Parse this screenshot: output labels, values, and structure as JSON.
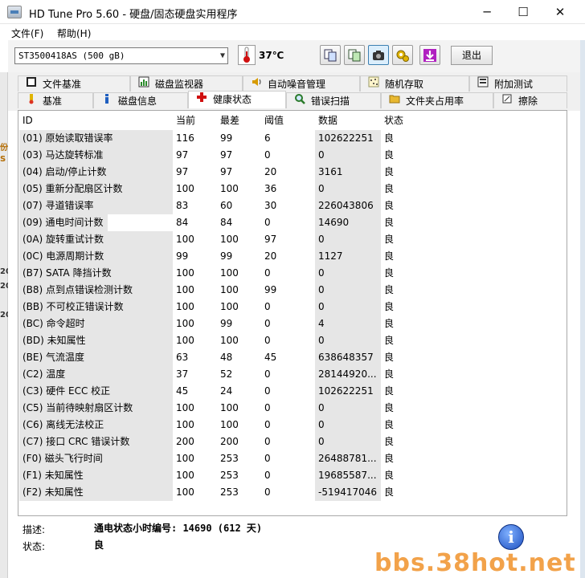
{
  "window": {
    "title": "HD Tune Pro 5.60 - 硬盘/固态硬盘实用程序",
    "minimize": "─",
    "maximize": "☐",
    "close": "✕"
  },
  "menu": {
    "file": "文件(F)",
    "help": "帮助(H)"
  },
  "toolbar": {
    "drive": "ST3500418AS (500 gB)",
    "temperature": "37℃",
    "exit_label": "退出"
  },
  "tabs_row1": [
    {
      "label": "文件基准",
      "icon": "file-benchmark-icon"
    },
    {
      "label": "磁盘监视器",
      "icon": "disk-monitor-icon"
    },
    {
      "label": "自动噪音管理",
      "icon": "speaker-icon"
    },
    {
      "label": "随机存取",
      "icon": "random-access-icon"
    },
    {
      "label": "附加测试",
      "icon": "extra-tests-icon"
    }
  ],
  "tabs_row2": [
    {
      "label": "基准",
      "icon": "benchmark-icon"
    },
    {
      "label": "磁盘信息",
      "icon": "info-icon"
    },
    {
      "label": "健康状态",
      "icon": "health-cross-icon"
    },
    {
      "label": "错误扫描",
      "icon": "magnifier-icon"
    },
    {
      "label": "文件夹占用率",
      "icon": "folder-icon"
    },
    {
      "label": "擦除",
      "icon": "erase-icon"
    }
  ],
  "table": {
    "headers": [
      "ID",
      "当前",
      "最差",
      "阈值",
      "数据",
      "状态"
    ],
    "rows": [
      [
        "(01) 原始读取错误率",
        "116",
        "99",
        "6",
        "102622251",
        "良"
      ],
      [
        "(03) 马达旋转标准",
        "97",
        "97",
        "0",
        "0",
        "良"
      ],
      [
        "(04) 启动/停止计数",
        "97",
        "97",
        "20",
        "3161",
        "良"
      ],
      [
        "(05) 重新分配扇区计数",
        "100",
        "100",
        "36",
        "0",
        "良"
      ],
      [
        "(07) 寻道错误率",
        "83",
        "60",
        "30",
        "226043806",
        "良"
      ],
      [
        "(09) 通电时间计数",
        "84",
        "84",
        "0",
        "14690",
        "良"
      ],
      [
        "(0A) 旋转重试计数",
        "100",
        "100",
        "97",
        "0",
        "良"
      ],
      [
        "(0C) 电源周期计数",
        "99",
        "99",
        "20",
        "1127",
        "良"
      ],
      [
        "(B7) SATA 降挡计数",
        "100",
        "100",
        "0",
        "0",
        "良"
      ],
      [
        "(B8) 点到点错误检测计数",
        "100",
        "100",
        "99",
        "0",
        "良"
      ],
      [
        "(BB) 不可校正错误计数",
        "100",
        "100",
        "0",
        "0",
        "良"
      ],
      [
        "(BC) 命令超时",
        "100",
        "99",
        "0",
        "4",
        "良"
      ],
      [
        "(BD) 未知属性",
        "100",
        "100",
        "0",
        "0",
        "良"
      ],
      [
        "(BE) 气流温度",
        "63",
        "48",
        "45",
        "638648357",
        "良"
      ],
      [
        "(C2) 温度",
        "37",
        "52",
        "0",
        "28144920...",
        "良"
      ],
      [
        "(C3) 硬件 ECC 校正",
        "45",
        "24",
        "0",
        "102622251",
        "良"
      ],
      [
        "(C5) 当前待映射扇区计数",
        "100",
        "100",
        "0",
        "0",
        "良"
      ],
      [
        "(C6) 离线无法校正",
        "100",
        "100",
        "0",
        "0",
        "良"
      ],
      [
        "(C7) 接口 CRC 错误计数",
        "200",
        "200",
        "0",
        "0",
        "良"
      ],
      [
        "(F0) 磁头飞行时间",
        "100",
        "253",
        "0",
        "26488781...",
        "良"
      ],
      [
        "(F1) 未知属性",
        "100",
        "253",
        "0",
        "19685587...",
        "良"
      ],
      [
        "(F2) 未知属性",
        "100",
        "253",
        "0",
        "-519417046",
        "良"
      ]
    ]
  },
  "footer": {
    "desc_label": "描述:",
    "desc_value": "通电状态小时编号: 14690 (612 天)",
    "status_label": "状态:",
    "status_value": "良"
  },
  "watermark": "bbs.38hot.net",
  "left_strip_fragments": [
    "份",
    "S",
    "20",
    "20",
    "20"
  ]
}
